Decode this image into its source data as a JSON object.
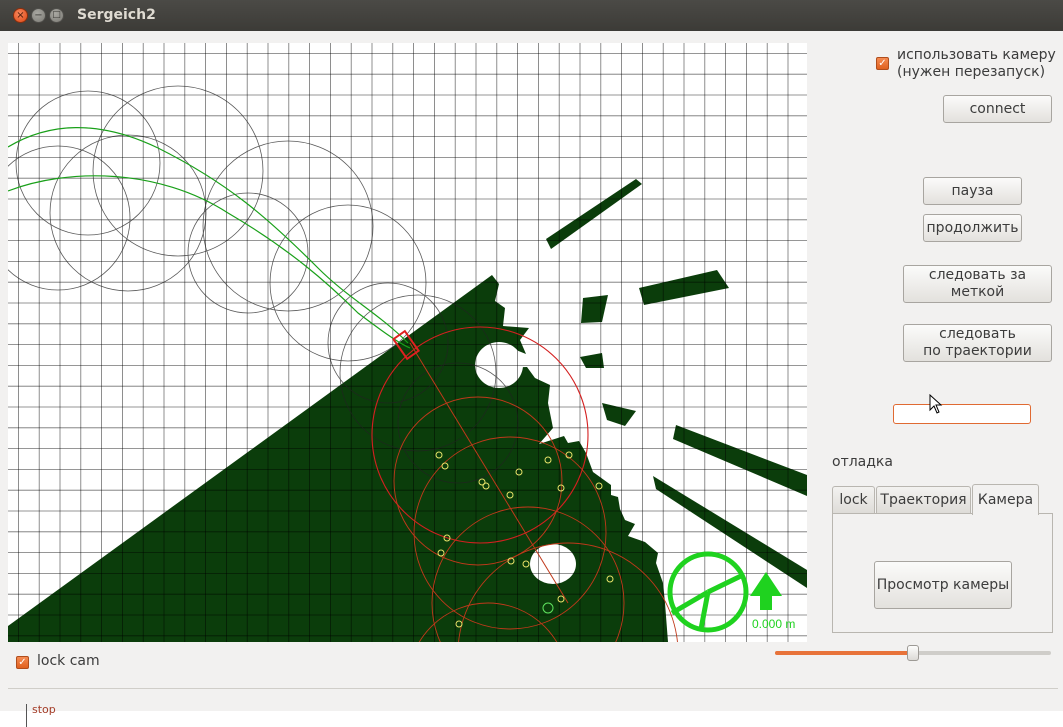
{
  "window": {
    "title": "Sergeich2",
    "close_glyph": "×",
    "min_glyph": "−",
    "max_glyph": "□"
  },
  "right_panel": {
    "camera_checkbox": {
      "checked": true,
      "label_line1": "использовать камеру",
      "label_line2": "(нужен перезапуск)"
    },
    "connect_button": "connect",
    "pause_button": "пауза",
    "continue_button": "продолжить",
    "follow_marker_button": "следовать за меткой",
    "follow_path_button_line1": "следовать",
    "follow_path_button_line2": "по траектории",
    "text_field_value": "",
    "debug_label": "отладка",
    "tabs": [
      {
        "label": "lock",
        "active": false
      },
      {
        "label": "Траектория",
        "active": false
      },
      {
        "label": "Камера",
        "active": true
      }
    ],
    "camera_view_button": "Просмотр камеры",
    "slider_value": 0.5
  },
  "bottom": {
    "lock_cam_checked": true,
    "lock_cam_label": "lock cam"
  },
  "map": {
    "speed_readout": "0.000 m",
    "colors": {
      "obstacle": "#0b3d0b",
      "grid": "#000000",
      "path": "#19a019",
      "robot": "#d42b2b",
      "hud": "#1fd21f"
    }
  },
  "background_window": {
    "text": "stop"
  },
  "icons": [
    "close-icon",
    "minimize-icon",
    "maximize-icon",
    "checkmark-icon",
    "steering-wheel-icon",
    "arrow-up-icon",
    "mouse-cursor-icon"
  ]
}
